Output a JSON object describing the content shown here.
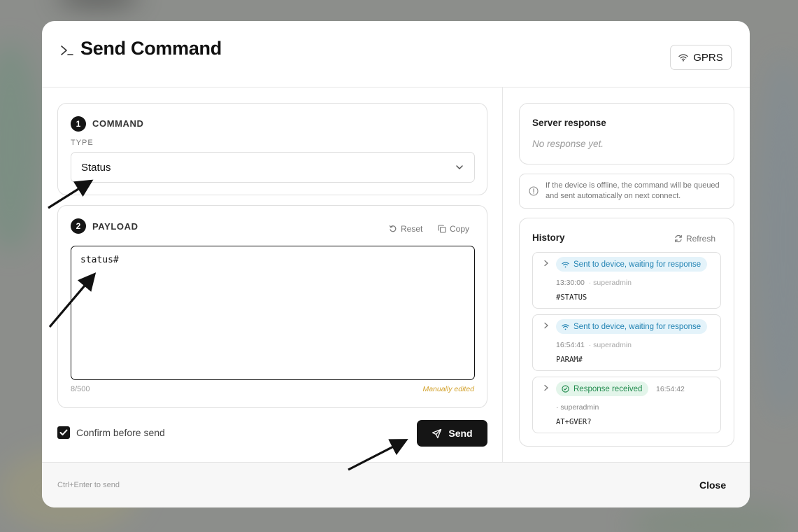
{
  "dialog": {
    "title": "Send Command",
    "title_icon": "terminal-icon",
    "connection_label": "GPRS",
    "connection_icon": "wifi-icon"
  },
  "command": {
    "step": "1",
    "section_label": "COMMAND",
    "type_label": "TYPE",
    "type_value": "Status"
  },
  "payload": {
    "step": "2",
    "section_label": "PAYLOAD",
    "reset_label": "Reset",
    "copy_label": "Copy",
    "value": "status#",
    "counter": "8/500",
    "edited_note": "Manually edited"
  },
  "actions": {
    "confirm_label": "Confirm before send",
    "confirm_checked": true,
    "send_label": "Send"
  },
  "server_response": {
    "title": "Server response",
    "empty_text": "No response yet."
  },
  "info_note": "If the device is offline, the command will be queued and sent automatically on next connect.",
  "history": {
    "title": "History",
    "refresh_label": "Refresh",
    "items": [
      {
        "status": "Sent to device, waiting for response",
        "status_type": "sent",
        "time": "13:30:00",
        "user": "· superadmin",
        "command": "#STATUS"
      },
      {
        "status": "Sent to device, waiting for response",
        "status_type": "sent",
        "time": "16:54:41",
        "user": "· superadmin",
        "command": "PARAM#"
      },
      {
        "status": "Response received",
        "status_type": "received",
        "time": "16:54:42",
        "user": "· superadmin",
        "command": "AT+GVER?"
      }
    ]
  },
  "footer": {
    "hint": "Ctrl+Enter to send",
    "close_label": "Close"
  },
  "colors": {
    "primary": "#151515",
    "sent_badge_bg": "#e4f3fa",
    "sent_badge_text": "#2283b3",
    "received_badge_bg": "#e3f5ea",
    "received_badge_text": "#1f8a4c",
    "edited_note": "#d3a22d"
  }
}
